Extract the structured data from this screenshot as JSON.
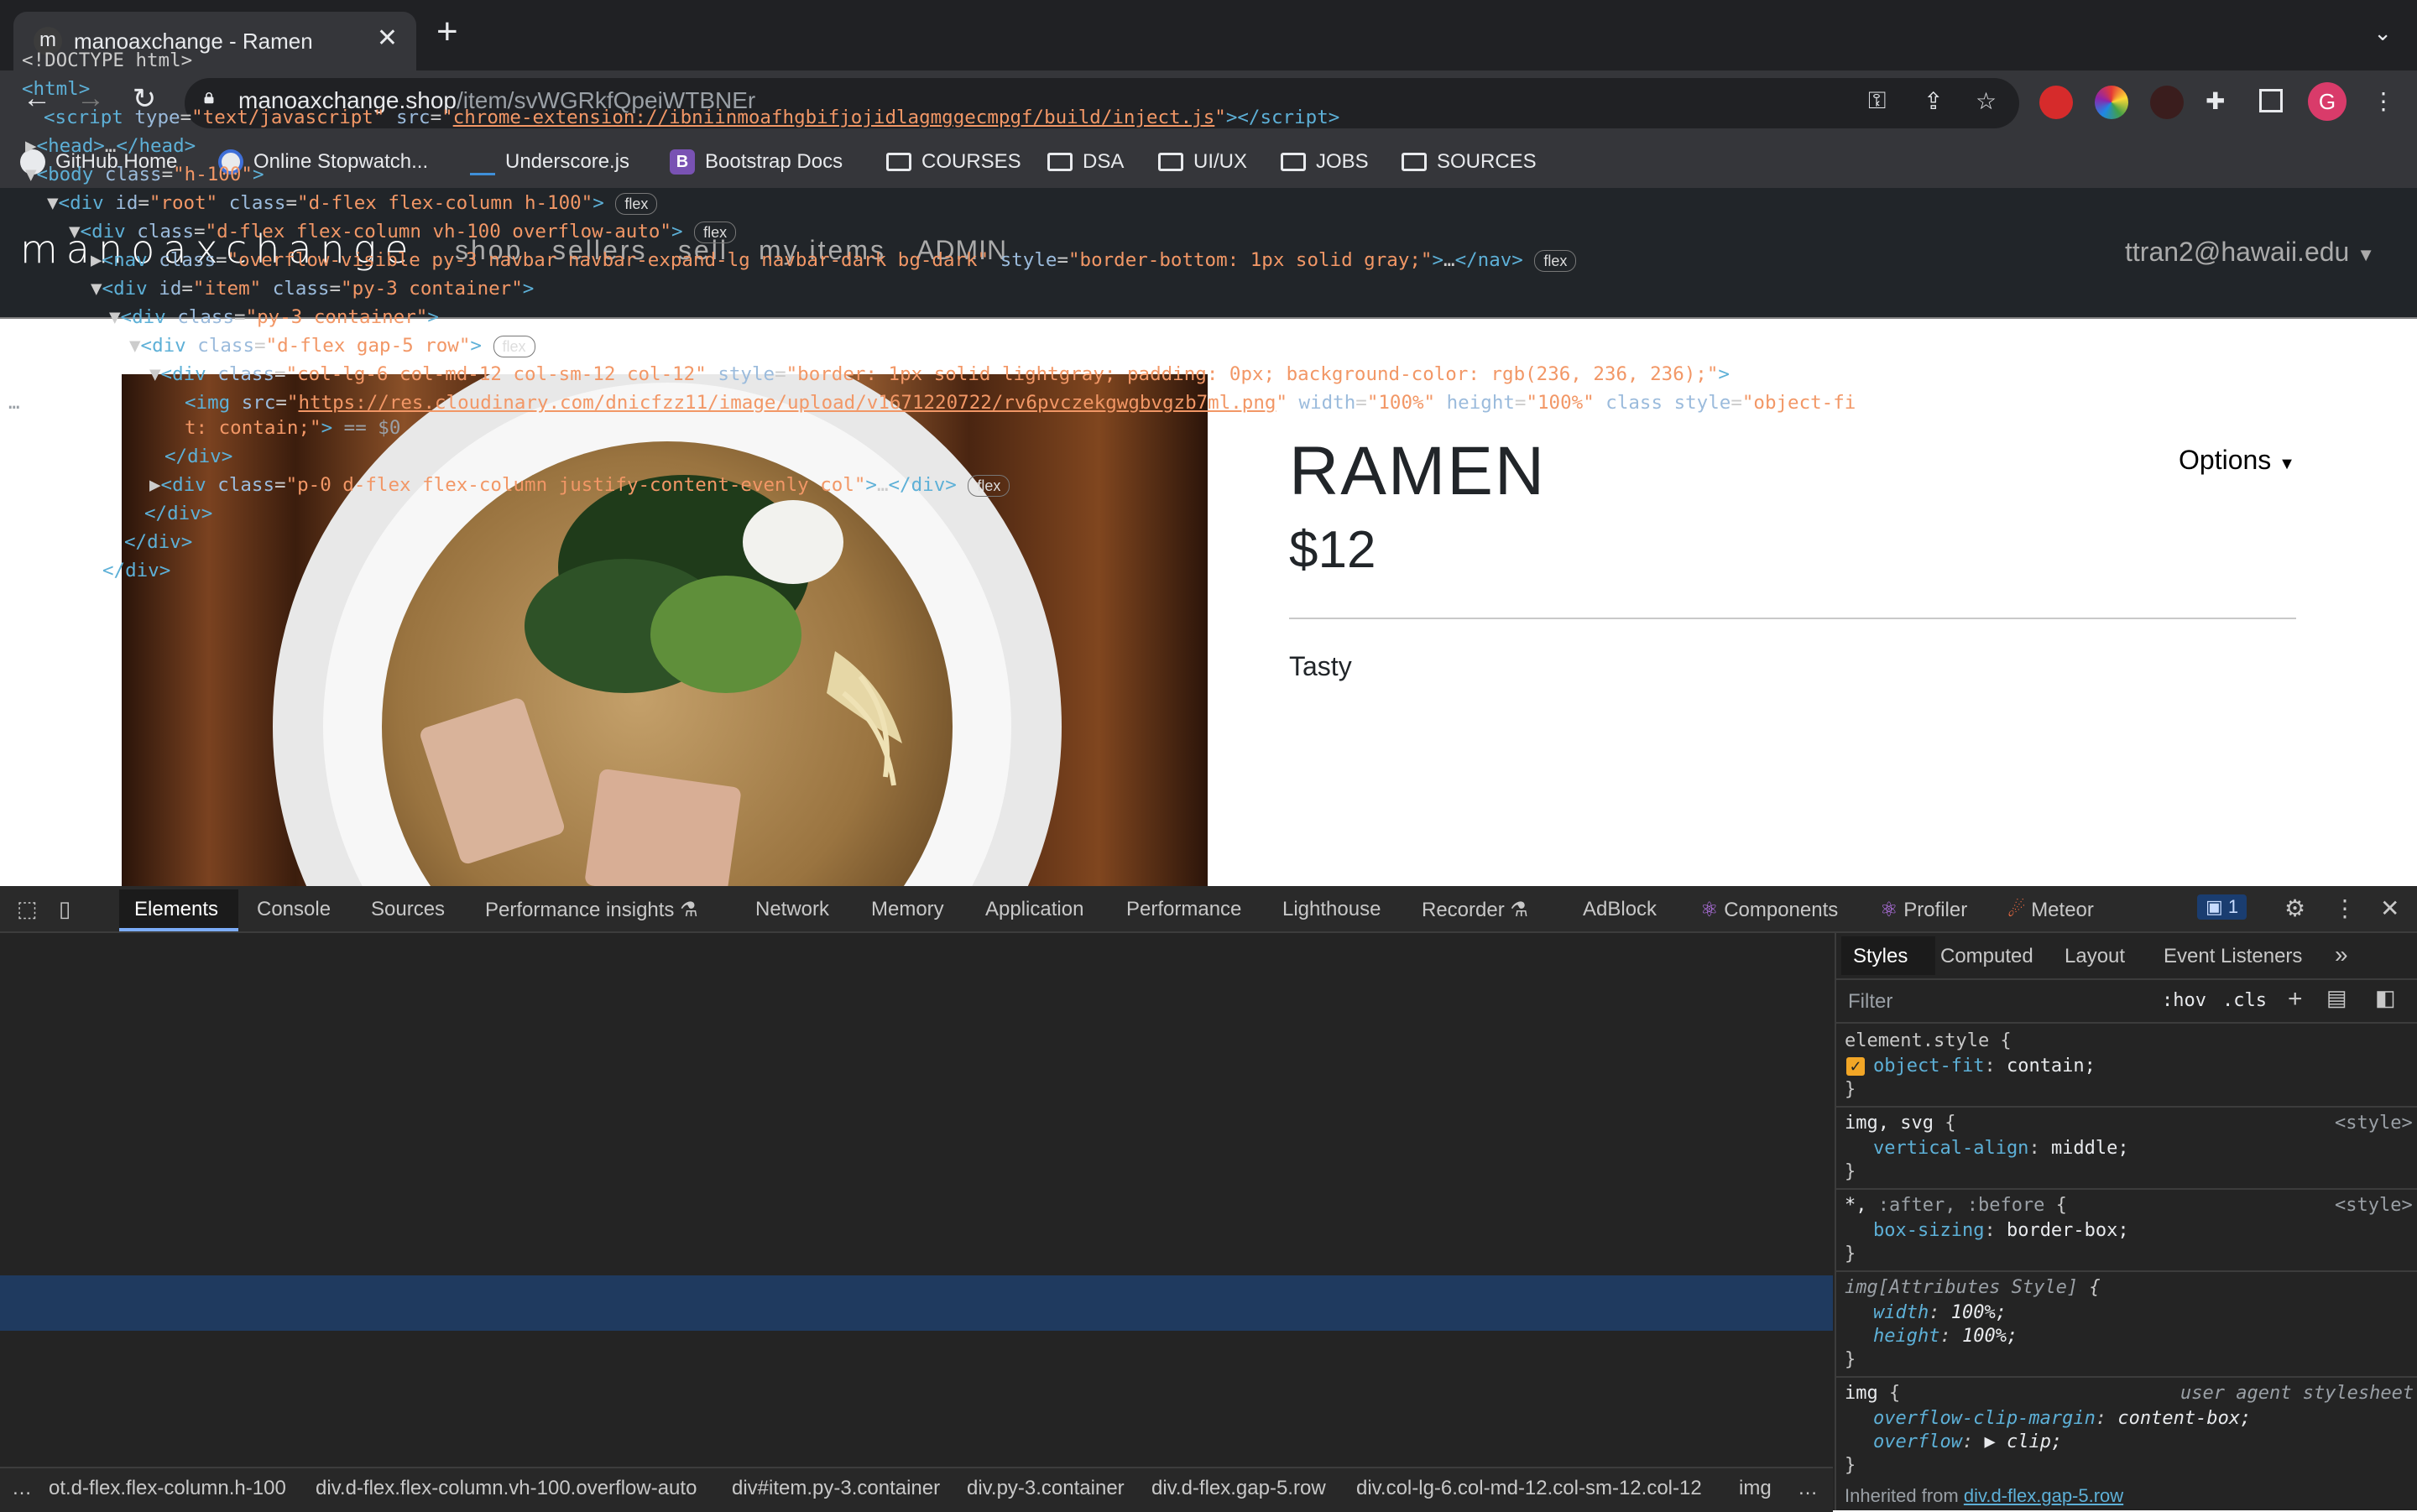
{
  "browser": {
    "tab_title": "manoaxchange - Ramen",
    "tab_favicon": "m",
    "url_host": "manoaxchange.shop",
    "url_path": "/item/svWGRkfQpeiWTBNEr",
    "avatar_letter": "G",
    "bookmarks": [
      {
        "label": "GitHub Home",
        "icon": "github-icon"
      },
      {
        "label": "Online Stopwatch...",
        "icon": "stopwatch-icon"
      },
      {
        "label": "Underscore.js",
        "icon": "underscore-icon"
      },
      {
        "label": "Bootstrap Docs",
        "icon": "bootstrap-icon"
      },
      {
        "label": "COURSES",
        "icon": "folder-icon"
      },
      {
        "label": "DSA",
        "icon": "folder-icon"
      },
      {
        "label": "UI/UX",
        "icon": "folder-icon"
      },
      {
        "label": "JOBS",
        "icon": "folder-icon"
      },
      {
        "label": "SOURCES",
        "icon": "folder-icon"
      }
    ]
  },
  "site": {
    "brand": "manoaxchange",
    "nav": [
      "shop",
      "sellers",
      "sell",
      "my items",
      "ADMIN"
    ],
    "user": "ttran2@hawaii.edu",
    "item": {
      "title": "RAMEN",
      "price": "$12",
      "description": "Tasty",
      "options_label": "Options"
    }
  },
  "devtools": {
    "tabs": [
      "Elements",
      "Console",
      "Sources",
      "Performance insights",
      "Network",
      "Memory",
      "Application",
      "Performance",
      "Lighthouse",
      "Recorder",
      "AdBlock",
      "Components",
      "Profiler",
      "Meteor"
    ],
    "issues_count": "1",
    "styles_tabs": [
      "Styles",
      "Computed",
      "Layout",
      "Event Listeners"
    ],
    "filter_placeholder": "Filter",
    "hov": ":hov",
    "cls": ".cls",
    "crumbs": [
      "ot.d-flex.flex-column.h-100",
      "div.d-flex.flex-column.vh-100.overflow-auto",
      "div#item.py-3.container",
      "div.py-3.container",
      "div.d-flex.gap-5.row",
      "div.col-lg-6.col-md-12.col-sm-12.col-12",
      "img"
    ],
    "flex_badge": "flex",
    "dom_selected_suffix": "== $0"
  }
}
